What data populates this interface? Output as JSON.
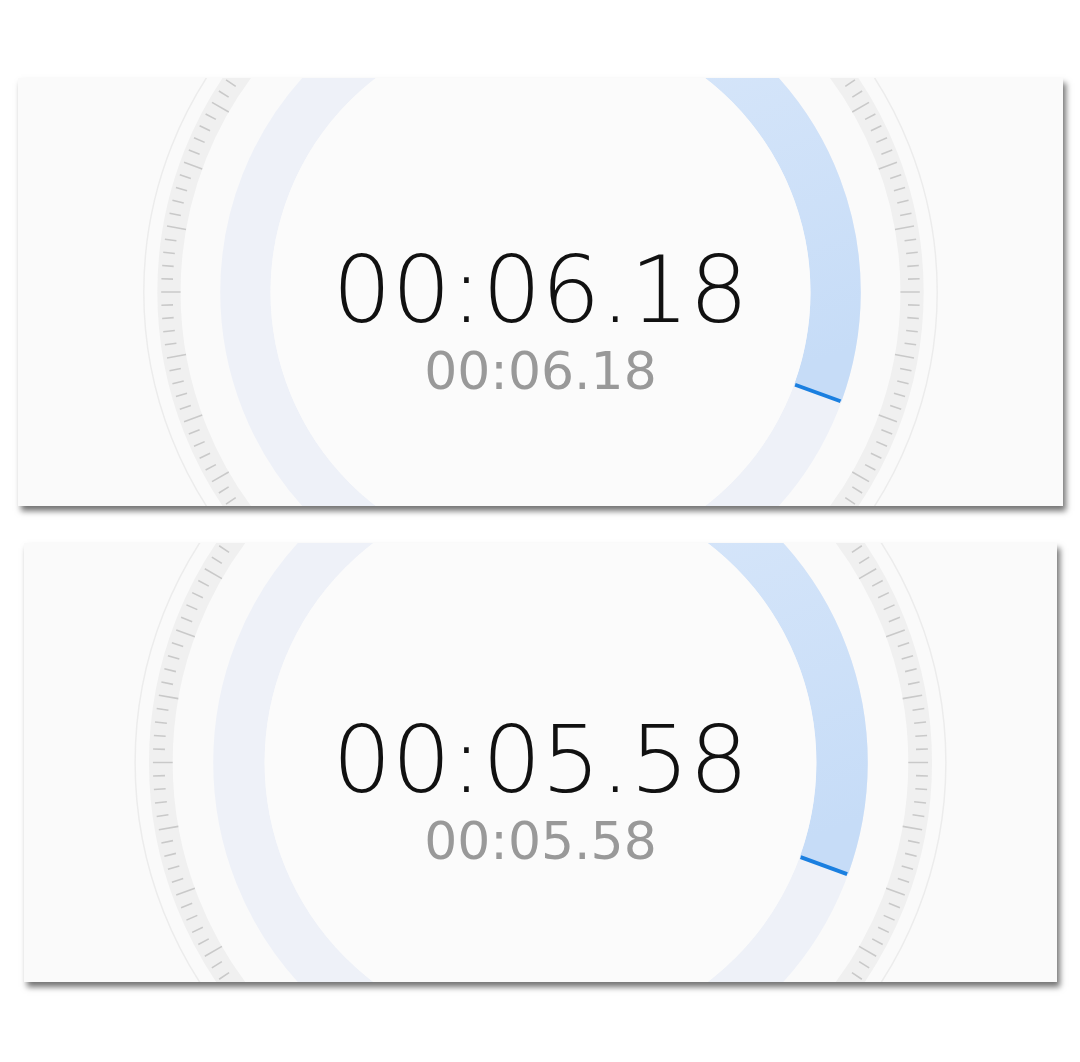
{
  "stopwatches": [
    {
      "elapsed": "00:06.18",
      "lap": "00:06.18"
    },
    {
      "elapsed": "00:05.58",
      "lap": "00:05.58"
    }
  ]
}
